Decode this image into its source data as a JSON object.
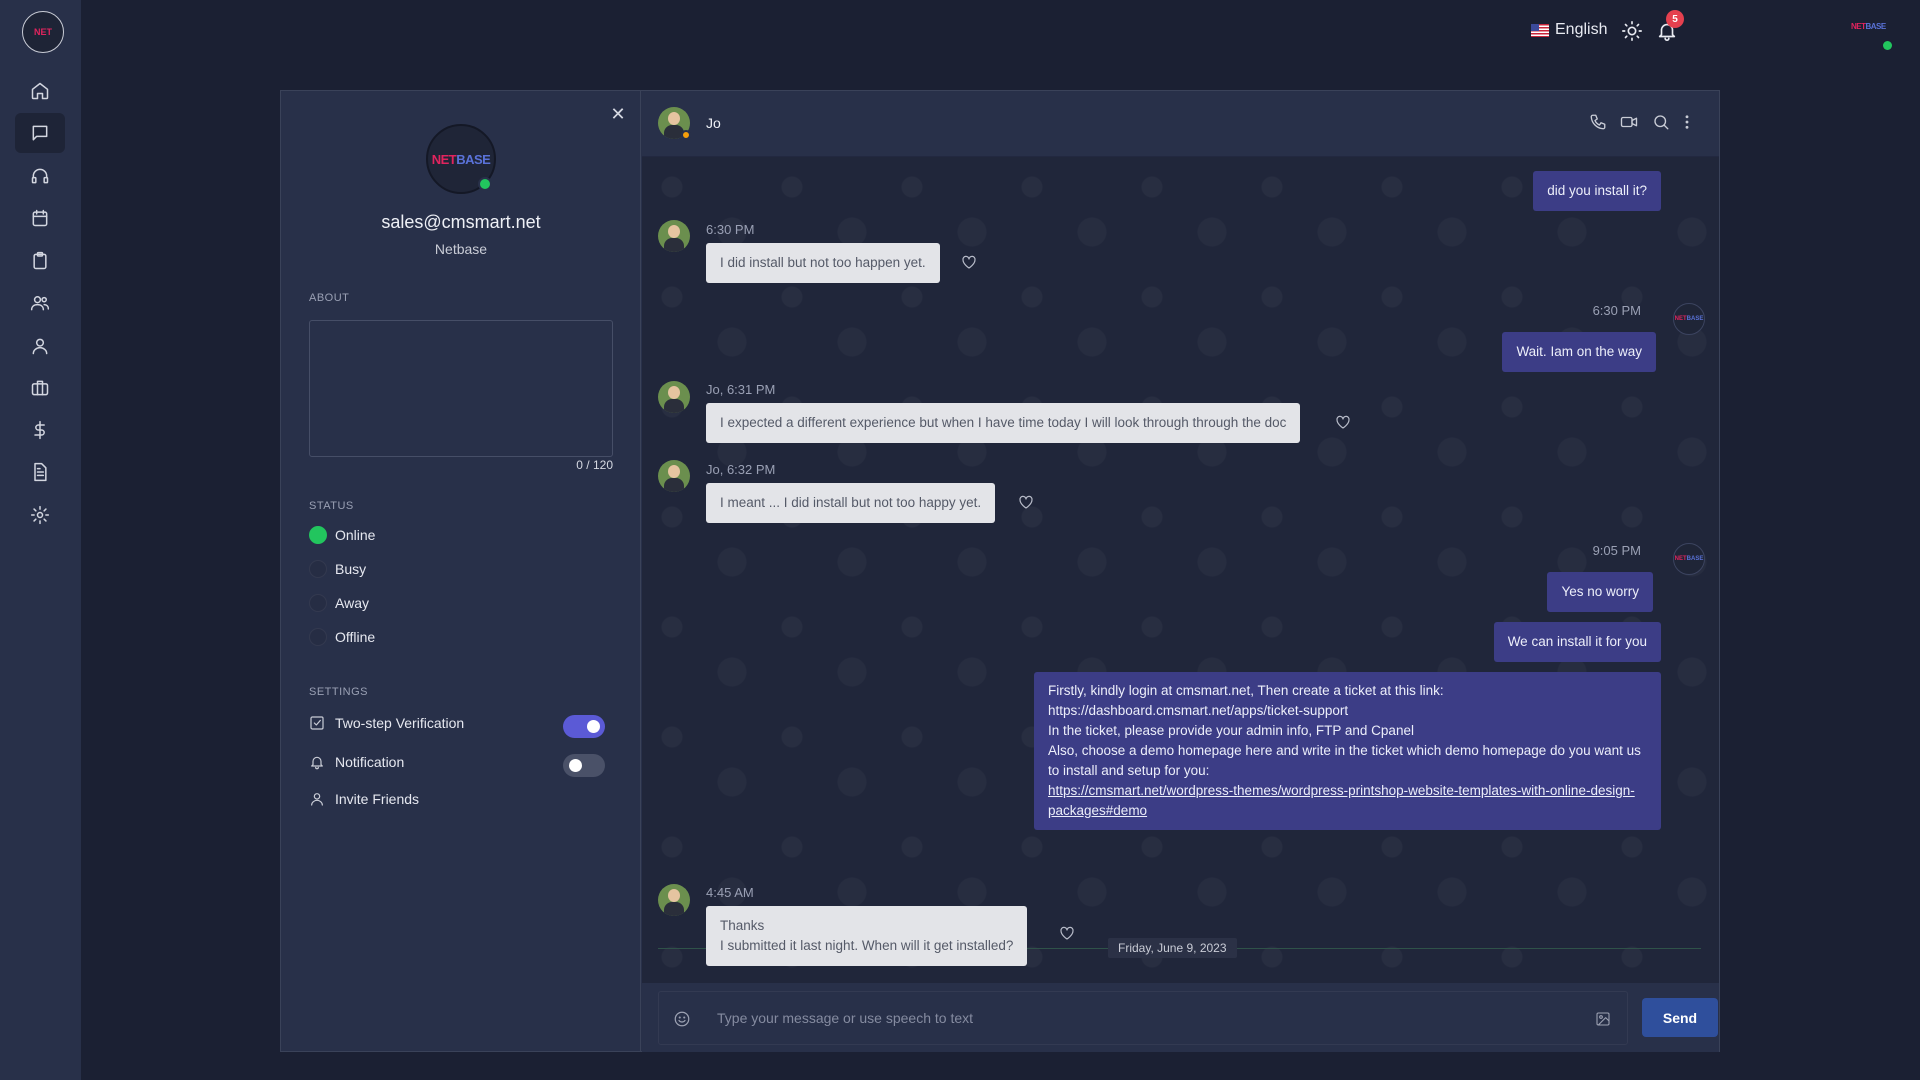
{
  "nav": {
    "logo_text": "NET",
    "items": [
      {
        "name": "home-icon"
      },
      {
        "name": "chat-icon",
        "active": true
      },
      {
        "name": "headset-icon"
      },
      {
        "name": "calendar-icon"
      },
      {
        "name": "clipboard-icon"
      },
      {
        "name": "users-icon"
      },
      {
        "name": "user-icon"
      },
      {
        "name": "briefcase-icon"
      },
      {
        "name": "dollar-icon"
      },
      {
        "name": "document-icon"
      },
      {
        "name": "settings-icon"
      }
    ]
  },
  "topbar": {
    "language": "English",
    "notification_count": "5",
    "avatar_text_a": "NET",
    "avatar_text_b": "BASE"
  },
  "profile": {
    "avatar_text_a": "NET",
    "avatar_text_b": "BASE",
    "email": "sales@cmsmart.net",
    "company": "Netbase",
    "about_label": "ABOUT",
    "about_count": "0 / 120",
    "status_label": "STATUS",
    "statuses": [
      {
        "label": "Online",
        "selected": true
      },
      {
        "label": "Busy",
        "selected": false
      },
      {
        "label": "Away",
        "selected": false
      },
      {
        "label": "Offline",
        "selected": false
      }
    ],
    "settings_label": "SETTINGS",
    "settings": [
      {
        "label": "Two-step Verification",
        "enabled": true
      },
      {
        "label": "Notification",
        "enabled": false
      },
      {
        "label": "Invite Friends"
      }
    ]
  },
  "chat": {
    "contact_name": "Jo",
    "messages": [
      {
        "direction": "out",
        "text": "did you install it?"
      },
      {
        "direction": "in",
        "meta": "6:30 PM",
        "text": "I did install but not too happen yet."
      },
      {
        "direction": "out",
        "meta": "6:30 PM",
        "text": "Wait. Iam on the way"
      },
      {
        "direction": "in",
        "meta": "Jo, 6:31 PM",
        "text": "I expected a different experience but when I have time today I will look through through the doc"
      },
      {
        "direction": "in",
        "meta": "Jo, 6:32 PM",
        "text": "I meant ... I did install but not too happy yet."
      },
      {
        "direction": "out",
        "meta": "9:05 PM",
        "text": "Yes no worry"
      },
      {
        "direction": "out",
        "text": "We can install it for you"
      },
      {
        "direction": "out",
        "lines": [
          "Firstly, kindly login at cmsmart.net, Then create a ticket at this link:",
          "https://dashboard.cmsmart.net/apps/ticket-support",
          "In the ticket, please provide your admin info, FTP and Cpanel",
          "Also, choose a demo homepage here and write in the ticket which demo homepage do you want us to install and setup for you:"
        ],
        "link": "https://cmsmart.net/wordpress-themes/wordpress-printshop-website-templates-with-online-design-packages#demo"
      },
      {
        "direction": "in",
        "meta": "4:45 AM",
        "lines": [
          "Thanks",
          "I submitted it last night. When will it get installed?"
        ]
      }
    ],
    "day_divider": "Friday, June 9, 2023",
    "composer_placeholder": "Type your message or use speech to text",
    "send_label": "Send"
  }
}
